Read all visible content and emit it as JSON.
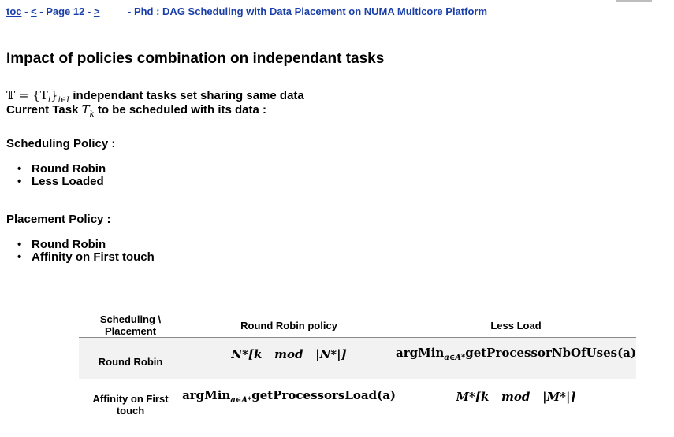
{
  "nav": {
    "toc": "toc",
    "sep1": " - ",
    "prev": "<",
    "sep2": " - Page ",
    "page": "12",
    "sep3": " - ",
    "next": ">",
    "doc_title": "- Phd : DAG Scheduling with Data Placement on NUMA Multicore Platform"
  },
  "page_title": "Impact of policies combination on independant tasks",
  "intro": {
    "math1": "𝕋 = {T",
    "math1_sub_i": "i",
    "math1_close": "}",
    "math1_sub_set": "i∈I",
    "text1": "independant tasks set sharing same data",
    "text2_before": "Current Task ",
    "math2": "T",
    "math2_sub": "k",
    "text2_after": " to be scheduled with its data :"
  },
  "scheduling": {
    "title": "Scheduling Policy :",
    "items": [
      "Round Robin",
      "Less Loaded"
    ]
  },
  "placement": {
    "title": "Placement Policy :",
    "items": [
      "Round Robin",
      "Affinity on First touch"
    ]
  },
  "table": {
    "headers": [
      "Scheduling \\ Placement",
      "Round Robin policy",
      "Less Load"
    ],
    "rows": [
      {
        "label": "Round Robin",
        "c1": "N*[k   mod   |N*|]",
        "c2_pre": "argMin",
        "c2_sub": "a∈A*",
        "c2_post": "getProcessorNbOfUses(a)"
      },
      {
        "label": "Affinity on First touch",
        "c1_pre": "argMin",
        "c1_sub": "a∈A*",
        "c1_post": "getProcessorsLoad(a)",
        "c2": "M*[k   mod   |M*|]"
      }
    ]
  },
  "colors": {
    "link": "#1a3fa8",
    "row_shade": "#f2f2f2",
    "divider": "#8a8a8a"
  }
}
